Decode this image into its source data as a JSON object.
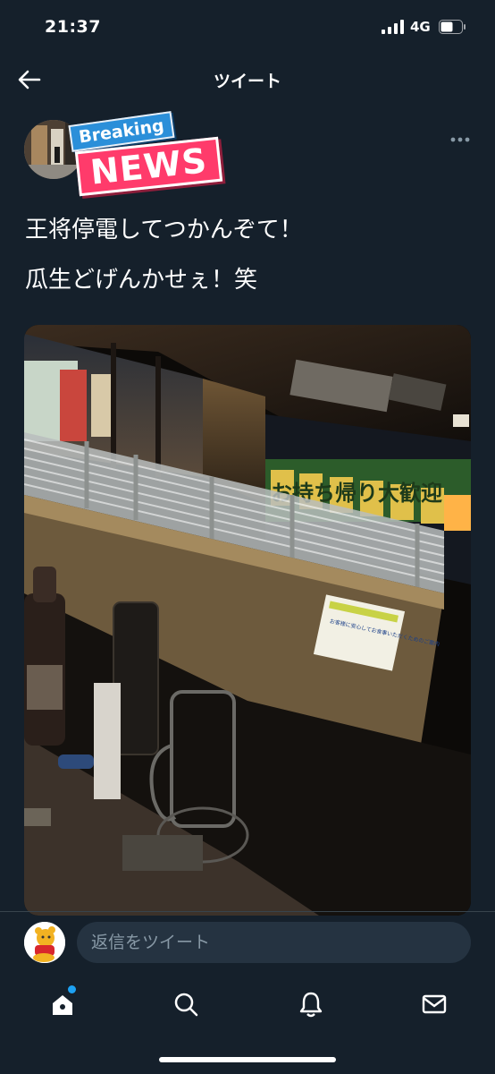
{
  "status_bar": {
    "time": "21:37",
    "network": "4G"
  },
  "nav": {
    "title": "ツイート",
    "back_icon": "arrow-left-icon"
  },
  "tweet": {
    "sticker_top": "Breaking",
    "sticker_bottom": "NEWS",
    "text_line1": "王将停電してつかんぞて！",
    "text_line2": "瓜生どげんかせぇ！笑",
    "media_sign_text": "お持ち帰り大歓迎",
    "media_notice_text": "お客様に安心してお食事いただくためのご案内"
  },
  "reply": {
    "placeholder": "返信をツイート"
  },
  "tabs": [
    {
      "name": "home",
      "icon": "home-icon"
    },
    {
      "name": "search",
      "icon": "search-icon"
    },
    {
      "name": "notifications",
      "icon": "bell-icon"
    },
    {
      "name": "messages",
      "icon": "mail-icon"
    }
  ],
  "colors": {
    "background": "#15202b",
    "accent": "#1da1f2",
    "input": "#253341",
    "divider": "#38444d"
  }
}
